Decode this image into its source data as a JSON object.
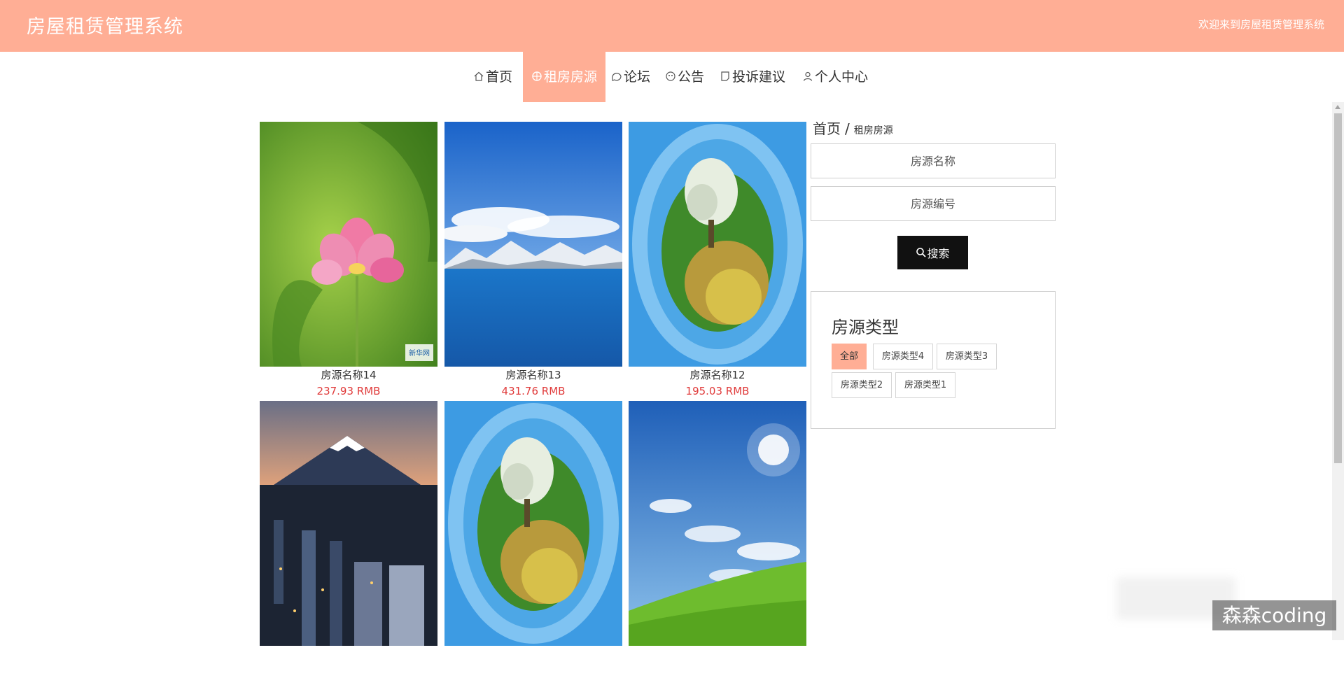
{
  "header": {
    "app_title": "房屋租赁管理系统",
    "welcome_text": "欢迎来到房屋租赁管理系统"
  },
  "nav": {
    "items": [
      {
        "label": "首页",
        "icon": "home-icon"
      },
      {
        "label": "租房房源",
        "icon": "grid-icon",
        "active": true
      },
      {
        "label": "论坛",
        "icon": "chat-icon"
      },
      {
        "label": "公告",
        "icon": "bell-icon"
      },
      {
        "label": "投诉建议",
        "icon": "note-icon"
      },
      {
        "label": "个人中心",
        "icon": "user-icon"
      }
    ]
  },
  "listings": [
    {
      "name": "房源名称14",
      "price": "237.93 RMB",
      "image": "pink-lotus-flower"
    },
    {
      "name": "房源名称13",
      "price": "431.76 RMB",
      "image": "blue-lake-snow-mountains"
    },
    {
      "name": "房源名称12",
      "price": "195.03 RMB",
      "image": "tiny-planet-tree"
    },
    {
      "name": "",
      "price": "",
      "image": "mountain-over-city-night"
    },
    {
      "name": "",
      "price": "",
      "image": "tiny-planet-tree"
    },
    {
      "name": "",
      "price": "",
      "image": "blue-sky-green-meadow"
    }
  ],
  "breadcrumb": {
    "home": "首页",
    "separator": "/",
    "current": "租房房源"
  },
  "search": {
    "name_placeholder": "房源名称",
    "code_placeholder": "房源编号",
    "button_label": "搜索"
  },
  "type_filter": {
    "title": "房源类型",
    "tags": [
      "全部",
      "房源类型4",
      "房源类型3",
      "房源类型2",
      "房源类型1"
    ],
    "selected": "全部"
  },
  "watermark": "森森coding",
  "colors": {
    "accent": "#ffae95",
    "price": "#e03a3a",
    "button": "#111111"
  }
}
